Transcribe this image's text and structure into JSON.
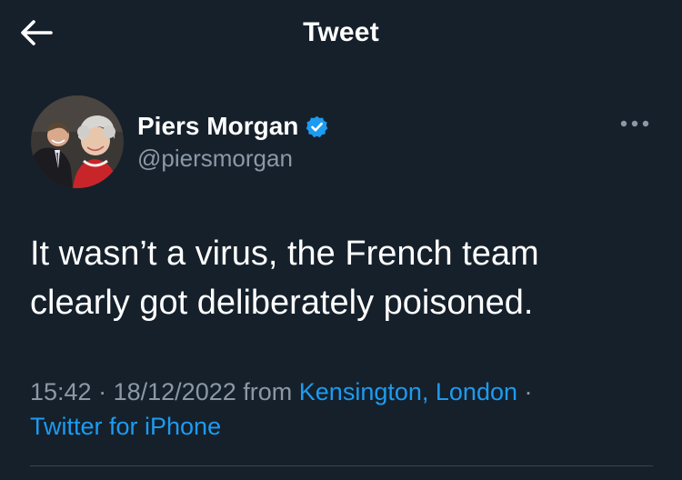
{
  "header": {
    "title": "Tweet",
    "back_icon": "arrow-left-icon"
  },
  "author": {
    "display_name": "Piers Morgan",
    "handle": "@piersmorgan",
    "verified_icon": "verified-badge-icon",
    "verified_color": "#1d9bf0"
  },
  "more_icon": "more-horizontal-icon",
  "tweet": {
    "text": "It wasn’t a virus, the French team\nclearly got deliberately poisoned.",
    "time": "15:42",
    "date": "18/12/2022",
    "from_label": "from",
    "location": "Kensington, London",
    "separator": "·",
    "source": "Twitter for iPhone"
  },
  "colors": {
    "background": "#15202b",
    "text_primary": "#ffffff",
    "text_secondary": "#8b98a5",
    "accent": "#1d9bf0",
    "divider": "#38444d"
  }
}
